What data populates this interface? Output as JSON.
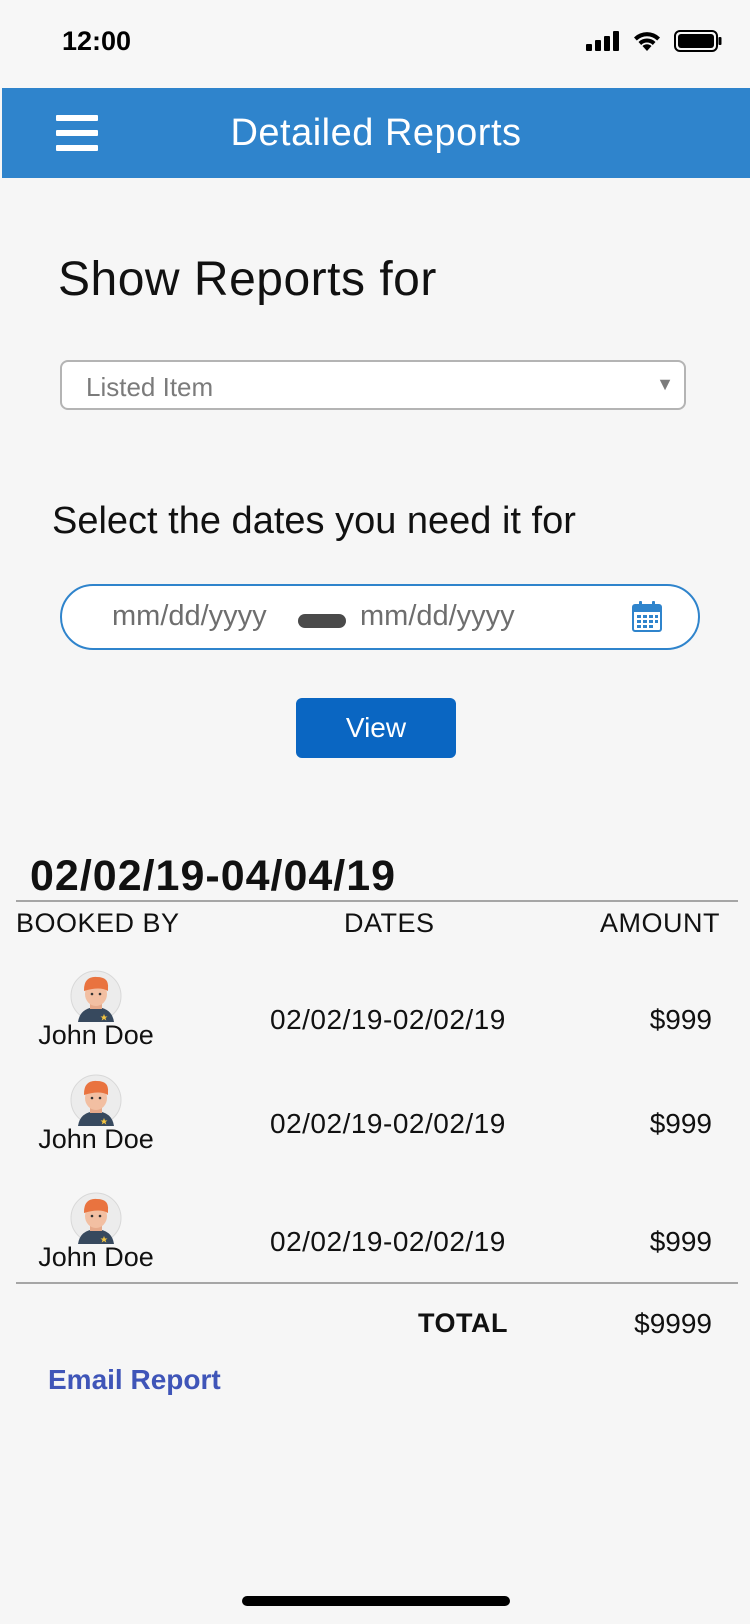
{
  "status": {
    "time": "12:00",
    "icons": [
      "signal-icon",
      "wifi-icon",
      "battery-icon"
    ]
  },
  "header": {
    "title": "Detailed Reports",
    "menu_icon": "hamburger-menu-icon",
    "background": "#2f84cc"
  },
  "filters": {
    "section_title": "Show Reports for",
    "select_value": "Listed Item",
    "dates_title": "Select the dates you need it for",
    "date_start_placeholder": "mm/dd/yyyy",
    "date_end_placeholder": "mm/dd/yyyy",
    "calendar_icon": "calendar-icon",
    "view_label": "View",
    "accent": "#0a66c2"
  },
  "report": {
    "range": "02/02/19-04/04/19",
    "columns": [
      "BOOKED BY",
      "DATES",
      "AMOUNT"
    ],
    "rows": [
      {
        "name": "John Doe",
        "dates": "02/02/19-02/02/19",
        "amount": "$999"
      },
      {
        "name": "John Doe",
        "dates": "02/02/19-02/02/19",
        "amount": "$999"
      },
      {
        "name": "John Doe",
        "dates": "02/02/19-02/02/19",
        "amount": "$999"
      }
    ],
    "total_label": "TOTAL",
    "total_value": "$9999",
    "email_label": "Email Report",
    "link_color": "#3f55b8"
  }
}
